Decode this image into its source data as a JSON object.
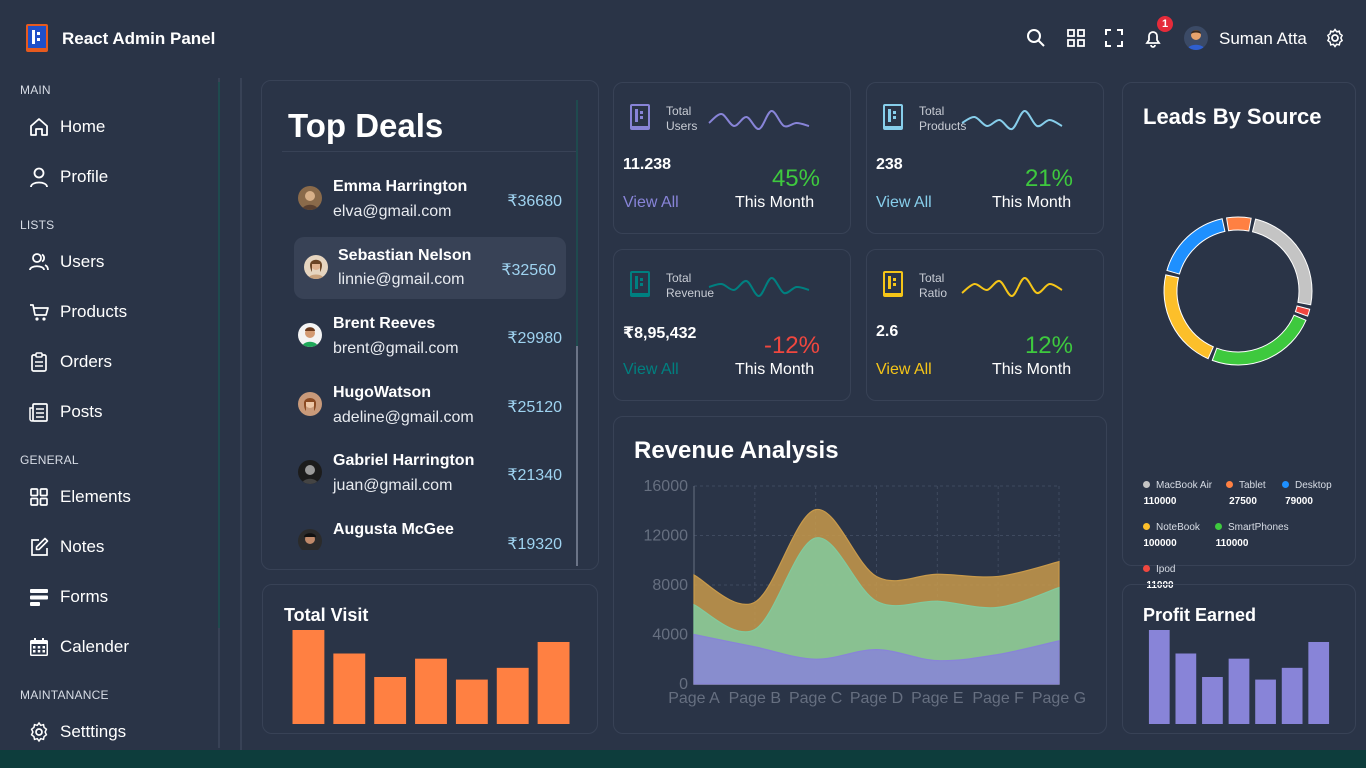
{
  "brand": {
    "title": "React Admin Panel"
  },
  "user": {
    "name": "Suman Atta",
    "notifications": "1"
  },
  "colors": {
    "bg": "#2a3447",
    "border": "#384256",
    "accent_orange": "#ff8042",
    "accent_purple": "#8884d8"
  },
  "sidebar": {
    "sections": [
      {
        "title": "MAIN",
        "items": [
          {
            "label": "Home",
            "icon": "home-icon"
          },
          {
            "label": "Profile",
            "icon": "profile-icon"
          }
        ]
      },
      {
        "title": "LISTS",
        "items": [
          {
            "label": "Users",
            "icon": "users-icon"
          },
          {
            "label": "Products",
            "icon": "cart-icon"
          },
          {
            "label": "Orders",
            "icon": "clipboard-icon"
          },
          {
            "label": "Posts",
            "icon": "posts-icon"
          }
        ]
      },
      {
        "title": "GENERAL",
        "items": [
          {
            "label": "Elements",
            "icon": "grid-icon"
          },
          {
            "label": "Notes",
            "icon": "notes-icon"
          },
          {
            "label": "Forms",
            "icon": "forms-icon"
          },
          {
            "label": "Calender",
            "icon": "calendar-icon"
          }
        ]
      },
      {
        "title": "MAINTANANCE",
        "items": [
          {
            "label": "Setttings",
            "icon": "gear-icon"
          }
        ]
      }
    ]
  },
  "top_deals": {
    "title": "Top Deals",
    "deals": [
      {
        "name": "Emma Harrington",
        "email": "elva@gmail.com",
        "amount": "₹36680"
      },
      {
        "name": "Sebastian Nelson",
        "email": "linnie@gmail.com",
        "amount": "₹32560"
      },
      {
        "name": "Brent Reeves",
        "email": "brent@gmail.com",
        "amount": "₹29980"
      },
      {
        "name": "HugoWatson",
        "email": "adeline@gmail.com",
        "amount": "₹25120"
      },
      {
        "name": "Gabriel Harrington",
        "email": "juan@gmail.com",
        "amount": "₹21340"
      },
      {
        "name": "Augusta McGee",
        "email": "",
        "amount": "₹19320"
      }
    ]
  },
  "stat_cards": [
    {
      "title": "Total Users",
      "value": "11.238",
      "link": "View All",
      "percent": "45%",
      "period": "This Month",
      "color": "#8884d8",
      "percent_color": "#3ec93e",
      "icon": "users-stat-icon",
      "spark": [
        5,
        8,
        4,
        7,
        3,
        9,
        4,
        5,
        4
      ]
    },
    {
      "title": "Total Products",
      "value": "238",
      "link": "View All",
      "percent": "21%",
      "period": "This Month",
      "color": "#87ceeb",
      "percent_color": "#3ec93e",
      "icon": "products-stat-icon",
      "spark": [
        5,
        7,
        4,
        6,
        3,
        9,
        4,
        6,
        4
      ]
    },
    {
      "title": "Total Revenue",
      "value": "₹8,95,432",
      "link": "View All",
      "percent": "-12%",
      "period": "This Month",
      "color": "#008080",
      "percent_color": "#f0473f",
      "icon": "revenue-stat-icon",
      "spark": [
        6,
        7,
        5,
        8,
        3,
        9,
        4,
        6,
        5
      ]
    },
    {
      "title": "Total Ratio",
      "value": "2.6",
      "link": "View All",
      "percent": "12%",
      "period": "This Month",
      "color": "#f5c518",
      "percent_color": "#3ec93e",
      "icon": "ratio-stat-icon",
      "spark": [
        4,
        7,
        5,
        8,
        3,
        9,
        4,
        7,
        5
      ]
    }
  ],
  "leads": {
    "title": "Leads By Source",
    "chart_data": {
      "type": "pie",
      "series": [
        {
          "name": "MacBook Air",
          "value": 110000,
          "color": "#c4c4c4"
        },
        {
          "name": "Ipod",
          "value": 11000,
          "color": "#f0473f"
        },
        {
          "name": "SmartPhones",
          "value": 110000,
          "color": "#3ec93e"
        },
        {
          "name": "NoteBook",
          "value": 100000,
          "color": "#fcbf2a"
        },
        {
          "name": "Desktop",
          "value": 79000,
          "color": "#1e90ff"
        },
        {
          "name": "Tablet",
          "value": 27500,
          "color": "#ff8042"
        }
      ]
    },
    "legend": [
      {
        "name": "MacBook Air",
        "value": "110000",
        "color": "#c4c4c4"
      },
      {
        "name": "Tablet",
        "value": "27500",
        "color": "#ff8042"
      },
      {
        "name": "Desktop",
        "value": "79000",
        "color": "#1e90ff"
      },
      {
        "name": "NoteBook",
        "value": "100000",
        "color": "#fcbf2a"
      },
      {
        "name": "SmartPhones",
        "value": "110000",
        "color": "#3ec93e"
      },
      {
        "name": "Ipod",
        "value": "11000",
        "color": "#f0473f"
      }
    ]
  },
  "revenue": {
    "title": "Revenue Analysis",
    "chart_data": {
      "type": "area",
      "categories": [
        "Page A",
        "Page B",
        "Page C",
        "Page D",
        "Page E",
        "Page F",
        "Page G"
      ],
      "ylim": [
        0,
        16000
      ],
      "yticks": [
        "16000",
        "12000",
        "8000",
        "4000",
        "0"
      ],
      "series": [
        {
          "values": [
            4000,
            3000,
            2000,
            2780,
            1890,
            2390,
            3490
          ],
          "color": "#8884d8"
        },
        {
          "values": [
            2400,
            1398,
            9800,
            3908,
            4800,
            3800,
            4300
          ],
          "color": "#82ca9d"
        },
        {
          "values": [
            2400,
            2210,
            2290,
            2000,
            2181,
            2500,
            2100
          ],
          "color": "#c89a4b"
        }
      ]
    }
  },
  "total_visit": {
    "title": "Total Visit",
    "chart_data": {
      "type": "bar",
      "values": [
        4000,
        3000,
        2000,
        2780,
        1890,
        2390,
        3490
      ],
      "color": "#ff8042"
    }
  },
  "profit": {
    "title": "Profit Earned",
    "chart_data": {
      "type": "bar",
      "values": [
        4000,
        3000,
        2000,
        2780,
        1890,
        2390,
        3490
      ],
      "color": "#8884d8"
    }
  }
}
